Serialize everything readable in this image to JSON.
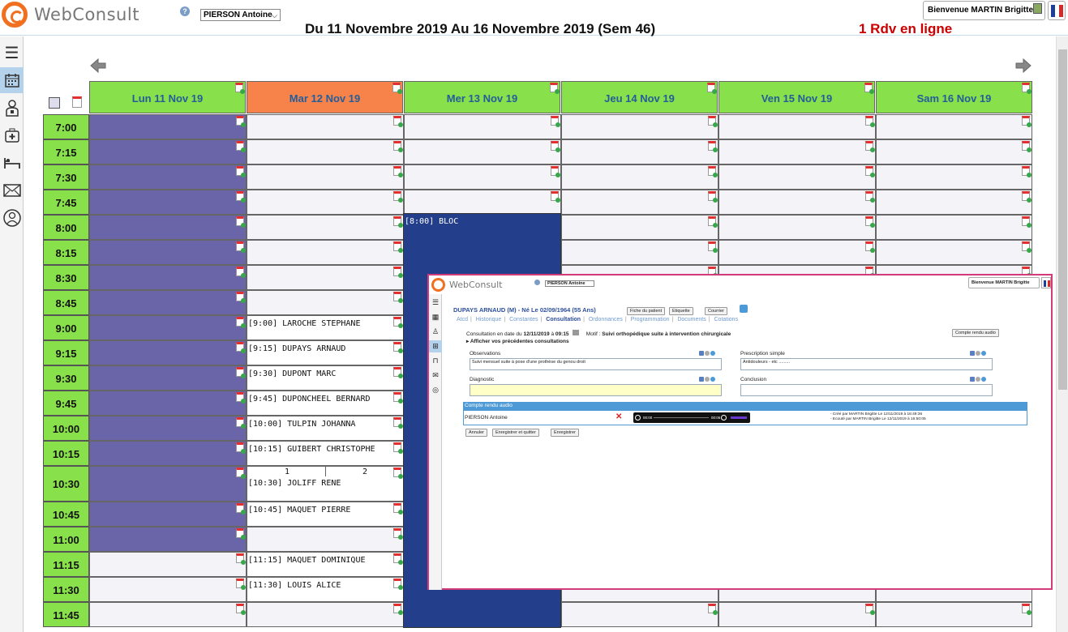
{
  "header": {
    "app_name": "WebConsult",
    "practitioner": "PIERSON Antoine",
    "welcome": "Bienvenue MARTIN Brigitte"
  },
  "calendar": {
    "week_title": "Du 11 Novembre 2019 Au 16 Novembre 2019 (Sem 46)",
    "online_rdv": "1 Rdv en ligne",
    "days": [
      "Lun 11 Nov 19",
      "Mar 12 Nov 19",
      "Mer 13 Nov 19",
      "Jeu 14 Nov 19",
      "Ven 15 Nov 19",
      "Sam 16 Nov 19"
    ],
    "times": [
      "7:00",
      "7:15",
      "7:30",
      "7:45",
      "8:00",
      "8:15",
      "8:30",
      "8:45",
      "9:00",
      "9:15",
      "9:30",
      "9:45",
      "10:00",
      "10:15",
      "10:30",
      "10:45",
      "11:00",
      "11:15",
      "11:30",
      "11:45"
    ],
    "bloc_label": "[8:00] BLOC",
    "appointments": {
      "a0900": "[9:00] LAROCHE STEPHANE",
      "a0915": "[9:15] DUPAYS ARNAUD",
      "a0930": "[9:30] DUPONT MARC",
      "a0945": "[9:45] DUPONCHEEL BERNARD",
      "a1000": "[10:00] TULPIN JOHANNA",
      "a1015": "[10:15] GUIBERT CHRISTOPHE",
      "a1030": "[10:30] JOLIFF RENE",
      "a1045": "[10:45] MAQUET PIERRE",
      "a1115": "[11:15] MAQUET DOMINIQUE",
      "a1130": "[11:30] LOUIS ALICE"
    },
    "split_labels": [
      "1",
      "2"
    ]
  },
  "popup": {
    "app_name": "WebConsult",
    "practitioner": "PIERSON Antoine",
    "welcome": "Bienvenue MARTIN Brigitte",
    "patient": "DUPAYS ARNAUD (M)  -  Né Le 02/09/1964 (55 Ans)",
    "buttons": {
      "fiche": "Fiche du patient",
      "etiquette": "Etiquette",
      "courrier": "Courrier",
      "compte_rendu": "Compte rendu audio"
    },
    "tabs": [
      "Atcd",
      "Historique",
      "Constantes",
      "Consultation",
      "Ordonnances",
      "Programmation",
      "Documents",
      "Cotations"
    ],
    "consult_prefix": "Consultation en date du",
    "consult_date": "12/11/2019",
    "consult_at": "à",
    "consult_time": "09:15",
    "motif_label": "Motif :",
    "motif": "Suivi orthopédique suite à intervention chirurgicale",
    "previous": "Afficher vos précédentes consultations",
    "observations_label": "Observations",
    "observations": "Suivi mensuel suite à pose d'une prothèse du genou droit",
    "prescription_label": "Prescription simple",
    "prescription": "Antidouleurs - etc .........",
    "diagnostic_label": "Diagnostic",
    "diagnostic": "",
    "conclusion_label": "Conclusion",
    "conclusion": "",
    "audio_header": "Compte rendu audio",
    "audio_author": "PIERSON Antoine",
    "audio_start": "00:00",
    "audio_end": "00:06",
    "audio_created": "- Créé par MARTIN Brigitte Le 12/11/2019 à 16:49:36",
    "audio_listened": "- Ecouté par MARTIN Brigitte Le 12/11/2019 à 16:50:05",
    "btn_cancel": "Annuler",
    "btn_save_quit": "Enregistrer et quitter",
    "btn_save": "Enregistrer"
  },
  "colors": {
    "time_green": "#88e04a",
    "today_orange": "#f7834a",
    "unavailable_purple": "#6a65a9",
    "bloc_blue": "#233f8c",
    "online_red": "#cc0000",
    "popup_border": "#d33a7a",
    "audio_blue": "#4d9ad6"
  },
  "icons": [
    "menu-icon",
    "calendar-icon",
    "doctor-icon",
    "medkit-icon",
    "bed-icon",
    "mail-icon",
    "user-icon",
    "prev-week-arrow-icon",
    "next-week-arrow-icon",
    "add-appointment-icon"
  ]
}
